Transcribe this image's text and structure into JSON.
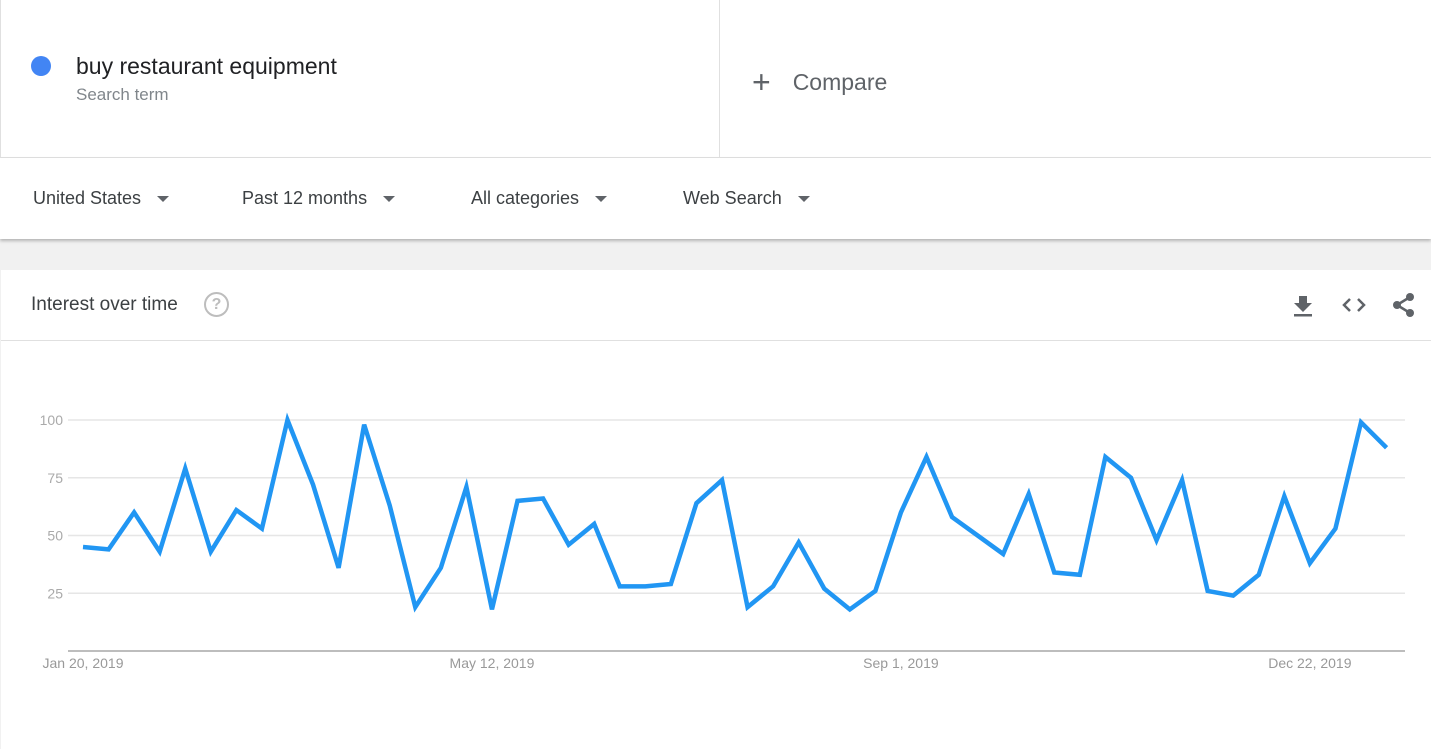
{
  "search_term": {
    "name": "buy restaurant equipment",
    "subtitle": "Search term",
    "color": "#4285f4"
  },
  "compare": {
    "label": "Compare",
    "icon": "plus-icon"
  },
  "filters": {
    "region": "United States",
    "time_range": "Past 12 months",
    "category": "All categories",
    "search_type": "Web Search"
  },
  "card": {
    "title": "Interest over time",
    "help_icon": "?",
    "actions": [
      "download-icon",
      "embed-icon",
      "share-icon"
    ]
  },
  "chart_data": {
    "type": "line",
    "title": "",
    "xlabel": "",
    "ylabel": "",
    "ylim": [
      0,
      100
    ],
    "yticks": [
      "25",
      "50",
      "75",
      "100"
    ],
    "xtick_labels": [
      "Jan 20, 2019",
      "May 12, 2019",
      "Sep 1, 2019",
      "Dec 22, 2019"
    ],
    "x_start": "Jan 20, 2019",
    "x_interval": "weekly",
    "grid": true,
    "color": "#2196f3",
    "values": [
      45,
      44,
      60,
      43,
      79,
      43,
      61,
      53,
      100,
      72,
      36,
      98,
      63,
      19,
      36,
      71,
      18,
      65,
      66,
      46,
      55,
      28,
      28,
      29,
      64,
      74,
      19,
      28,
      47,
      27,
      18,
      26,
      60,
      84,
      58,
      50,
      42,
      68,
      34,
      33,
      84,
      75,
      48,
      74,
      26,
      24,
      33,
      67,
      38,
      53,
      99,
      88
    ]
  }
}
